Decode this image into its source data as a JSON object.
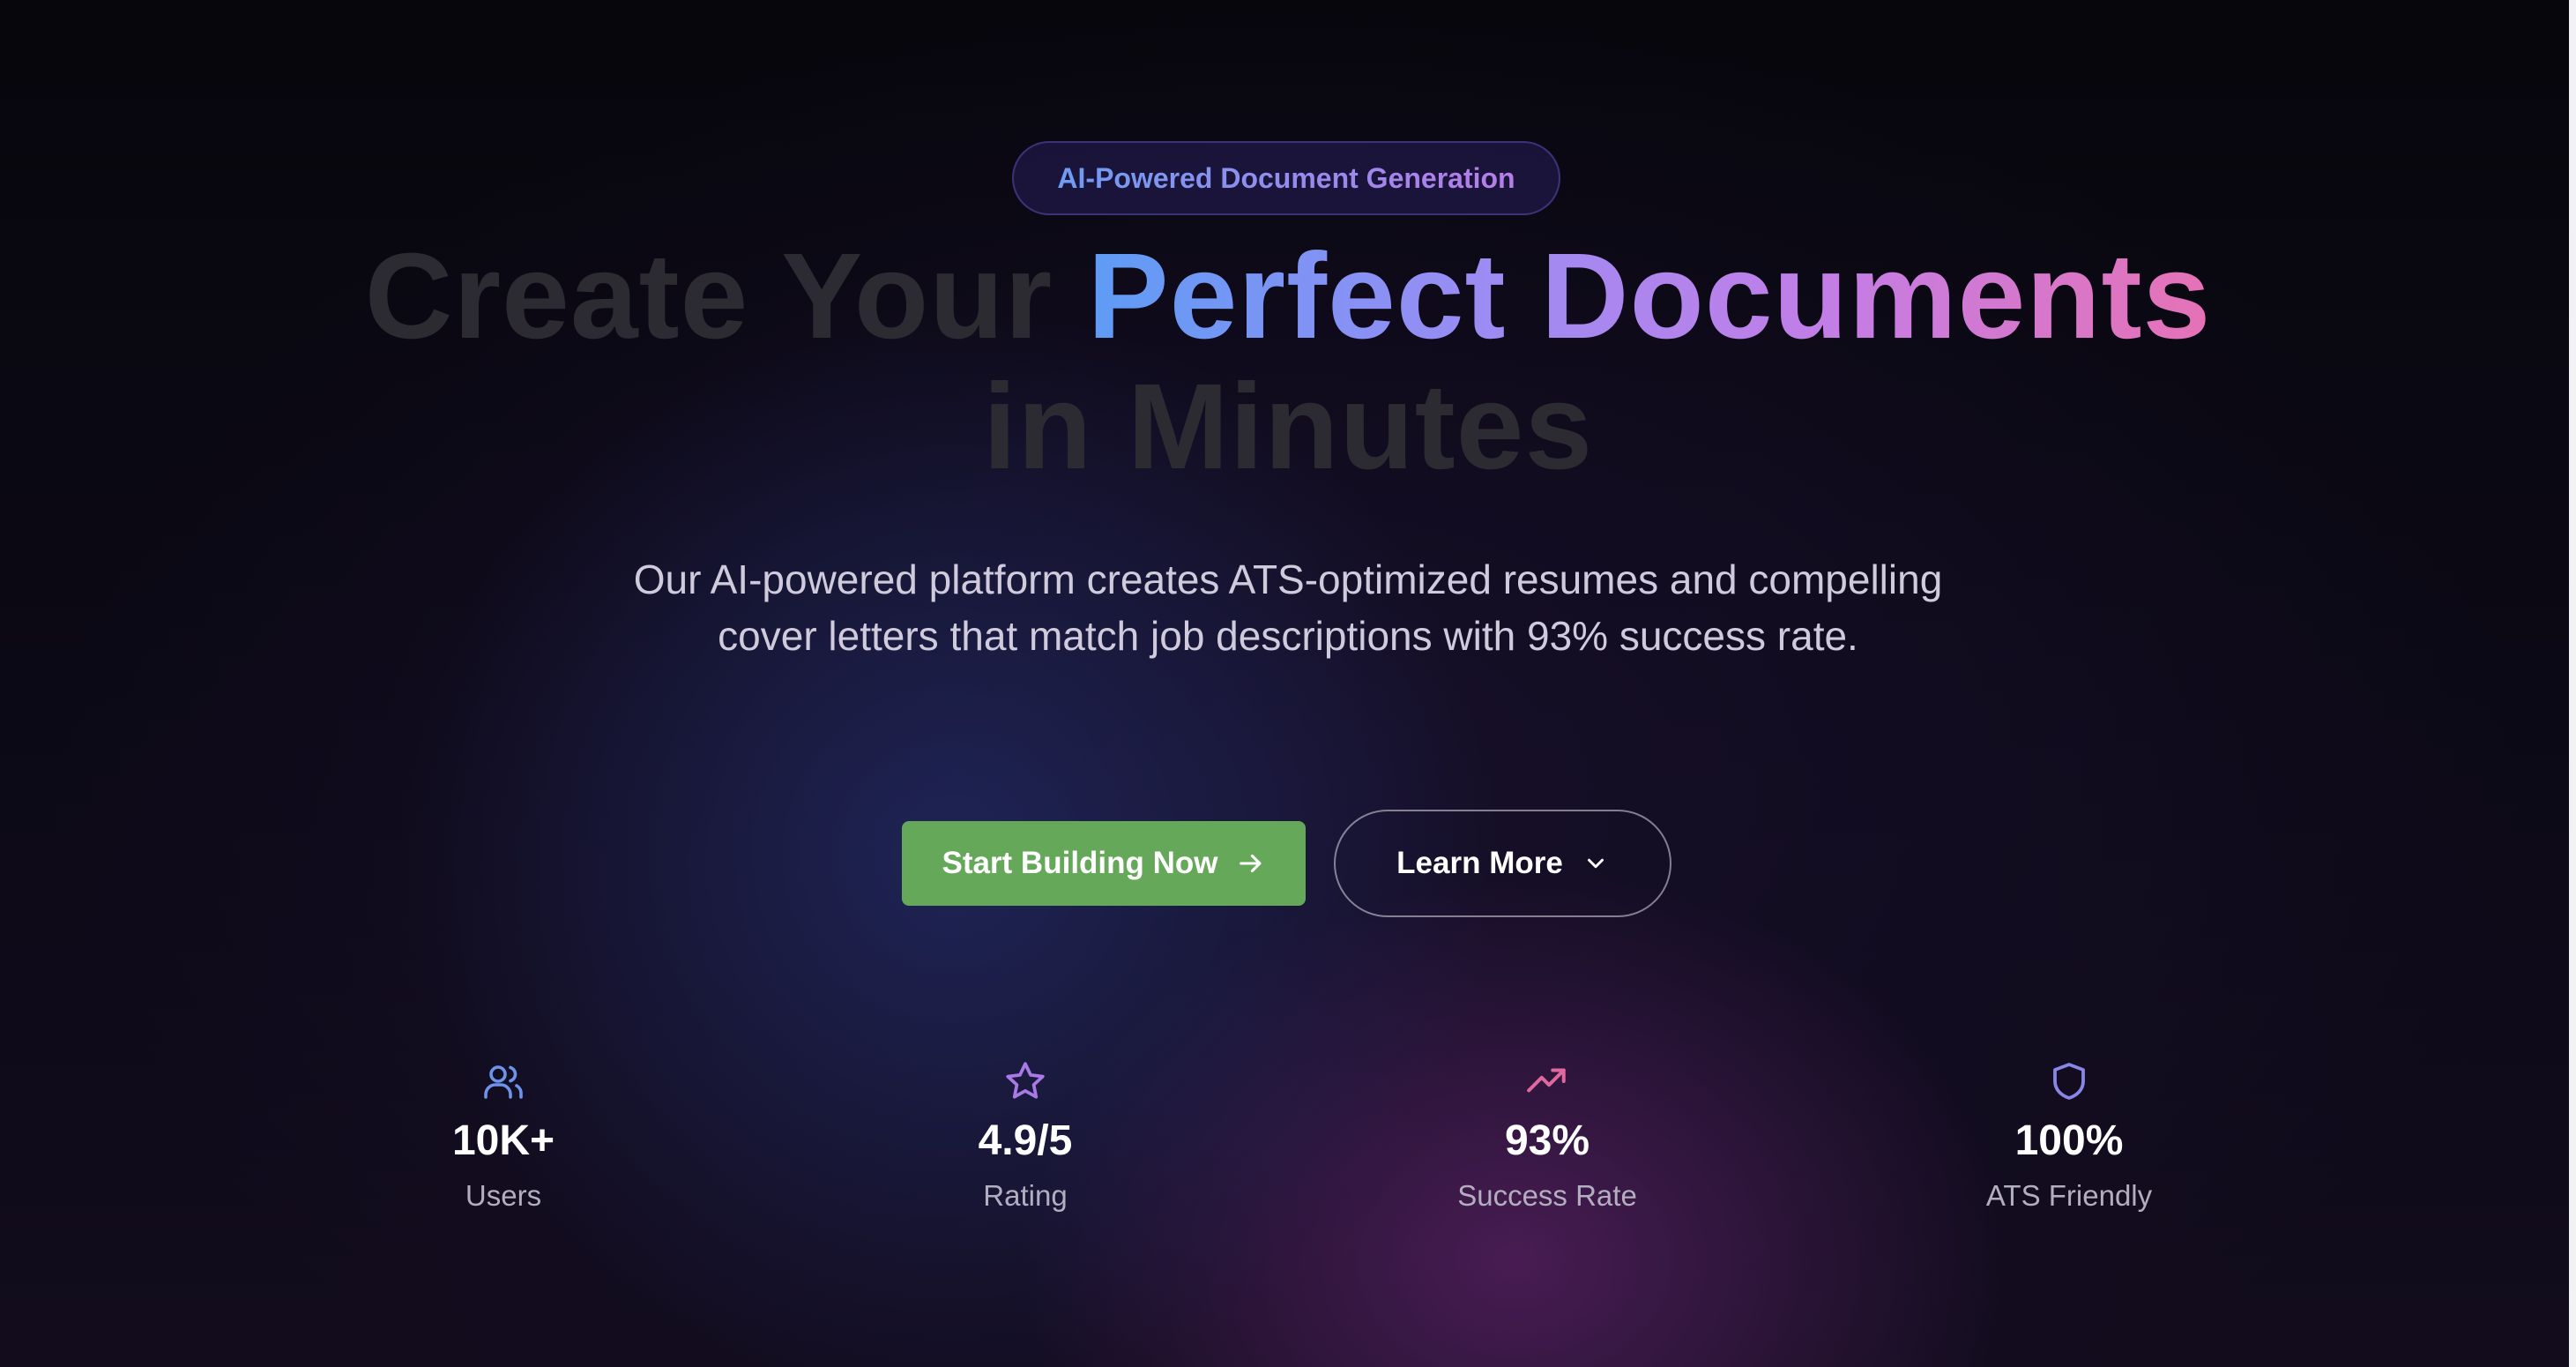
{
  "badge": {
    "text": "AI-Powered Document Generation"
  },
  "headline": {
    "line1_plain": "Create Your ",
    "line1_highlight": "Perfect Documents",
    "line2": "in Minutes"
  },
  "subtitle": "Our AI-powered platform creates ATS-optimized resumes and compelling cover letters that match job descriptions with 93% success rate.",
  "buttons": {
    "primary": {
      "label": "Start Building Now",
      "icon": "arrow-right-icon"
    },
    "secondary": {
      "label": "Learn More",
      "icon": "chevron-down-icon"
    }
  },
  "stats": [
    {
      "icon": "users-icon",
      "value": "10K+",
      "label": "Users",
      "color": "#6f93ea"
    },
    {
      "icon": "star-icon",
      "value": "4.9/5",
      "label": "Rating",
      "color": "#a979e6"
    },
    {
      "icon": "trending-up-icon",
      "value": "93%",
      "label": "Success Rate",
      "color": "#e0689f"
    },
    {
      "icon": "shield-icon",
      "value": "100%",
      "label": "ATS Friendly",
      "color": "#8a86e8"
    }
  ],
  "colors": {
    "primary_button": "#66a85a",
    "gradient_start": "#5e9cf5",
    "gradient_end": "#e672b6",
    "headline_muted": "#2c2b31"
  }
}
